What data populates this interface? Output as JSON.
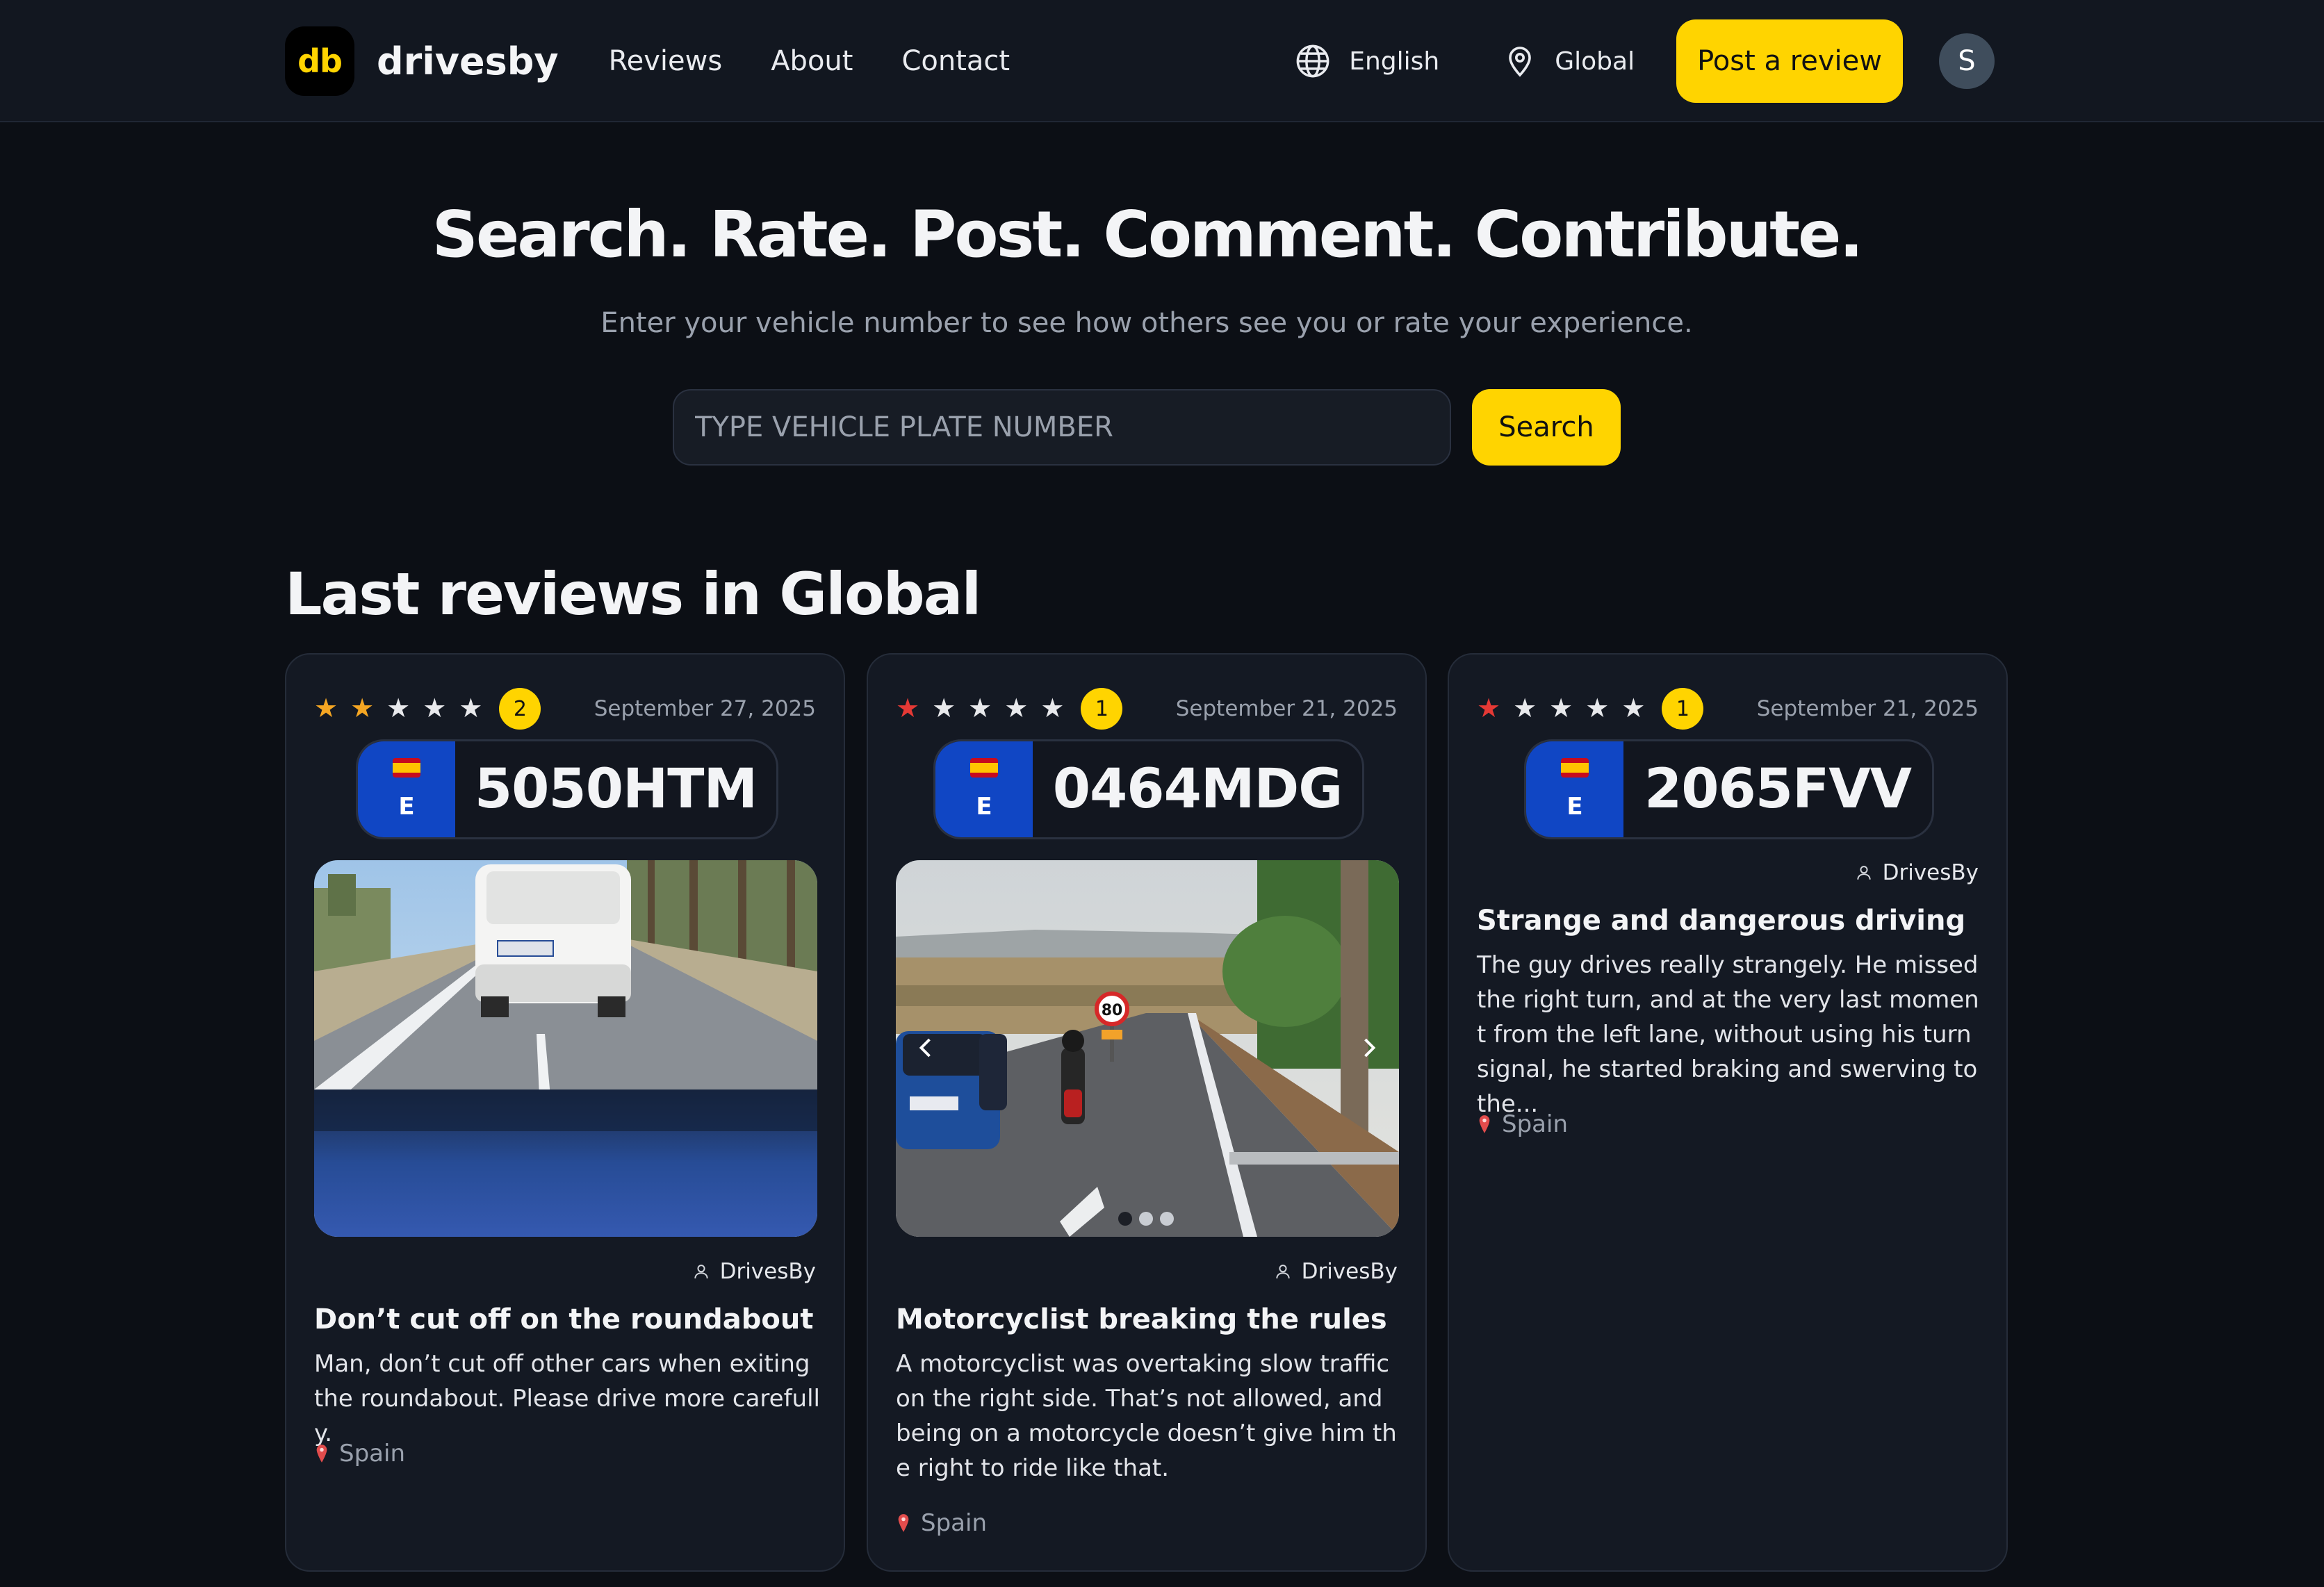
{
  "nav": {
    "logo_mark": "db",
    "logo_text": "drivesby",
    "links": [
      "Reviews",
      "About",
      "Contact"
    ],
    "language": "English",
    "location": "Global",
    "post_button": "Post a review",
    "avatar_initial": "S"
  },
  "hero": {
    "title": "Search. Rate. Post. Comment. Contribute.",
    "subtitle": "Enter your vehicle number to see how others see you or rate your experience.",
    "search_placeholder": "TYPE VEHICLE PLATE NUMBER",
    "search_button": "Search"
  },
  "section_title": "Last reviews in Global",
  "colors": {
    "accent": "#ffd400",
    "star_orange": "#f5a623",
    "star_red": "#e53935",
    "plate_blue": "#1046c4"
  },
  "reviews": [
    {
      "rating": 2,
      "date": "September 27, 2025",
      "plate_country": "E",
      "plate": "5050HTM",
      "author": "DrivesBy",
      "title": "Don’t cut off on the roundabout",
      "body": "Man, don’t cut off other cars when exiting the roundabout. Please drive more carefully.",
      "location": "Spain"
    },
    {
      "rating": 1,
      "date": "September 21, 2025",
      "plate_country": "E",
      "plate": "0464MDG",
      "author": "DrivesBy",
      "title": "Motorcyclist breaking the rules",
      "body": "A motorcyclist was overtaking slow traffic on the right side. That’s not allowed, and being on a motorcycle doesn’t give him the right to ride like that.",
      "location": "Spain",
      "speed_sign": "80"
    },
    {
      "rating": 1,
      "date": "September 21, 2025",
      "plate_country": "E",
      "plate": "2065FVV",
      "author": "DrivesBy",
      "title": "Strange and dangerous driving",
      "body": "The guy drives really strangely. He missed the right turn, and at the very last moment from the left lane, without using his turn signal, he started braking and swerving to the...",
      "location": "Spain"
    }
  ]
}
